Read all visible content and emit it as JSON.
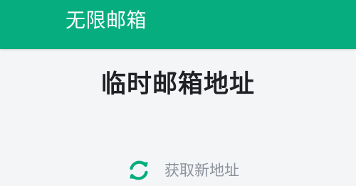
{
  "header": {
    "title": "无限邮箱",
    "background_color": "#06ad7f"
  },
  "main": {
    "title": "临时邮箱地址"
  },
  "actions": {
    "refresh": {
      "icon": "refresh-icon",
      "label": "获取新地址",
      "icon_color": "#06ad7f"
    }
  }
}
